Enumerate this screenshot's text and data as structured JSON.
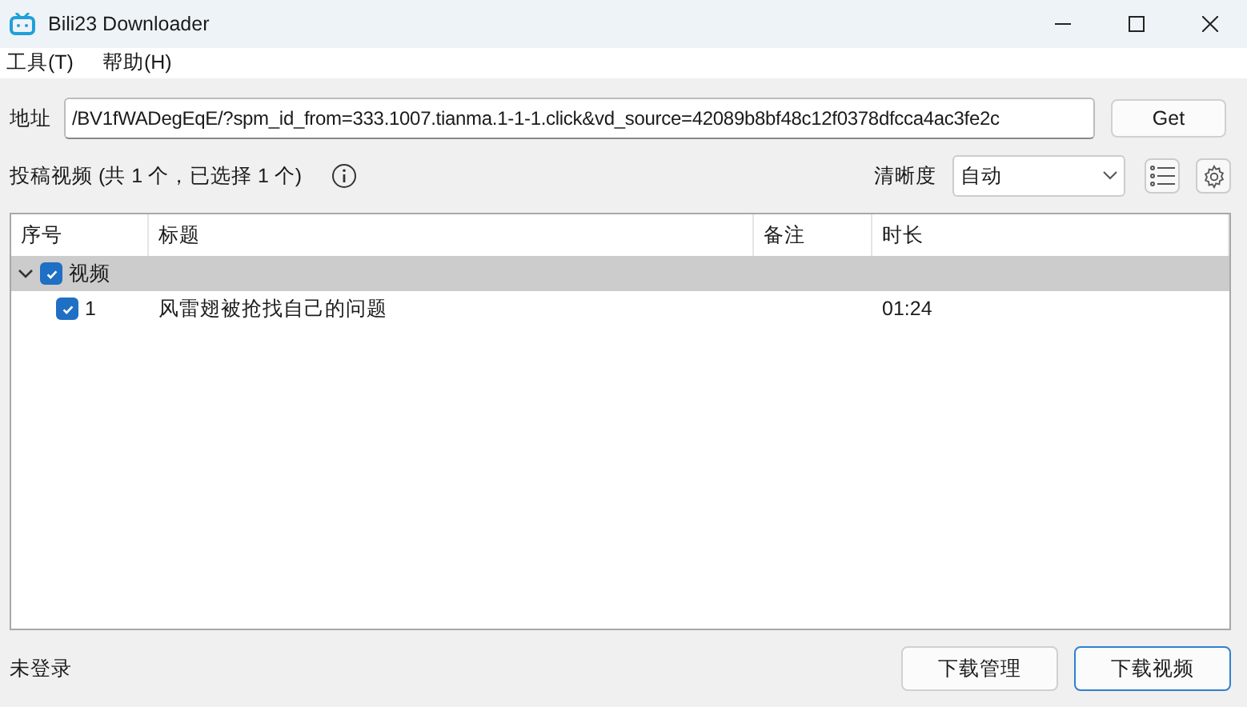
{
  "window": {
    "title": "Bili23 Downloader"
  },
  "menu": [
    "工具(T)",
    "帮助(H)"
  ],
  "address": {
    "label": "地址",
    "value": "/BV1fWADegEqE/?spm_id_from=333.1007.tianma.1-1-1.click&vd_source=42089b8bf48c12f0378dfcca4ac3fe2c",
    "button": "Get"
  },
  "summary": "投稿视频 (共 1 个，已选择 1 个)",
  "quality": {
    "label": "清晰度",
    "value": "自动"
  },
  "table": {
    "columns": [
      "序号",
      "标题",
      "备注",
      "时长"
    ],
    "groups": [
      {
        "label": "视频",
        "expanded": true,
        "checked": true,
        "rows": [
          {
            "index": "1",
            "title": "风雷翅被抢找自己的问题",
            "note": "",
            "duration": "01:24",
            "checked": true
          }
        ]
      }
    ]
  },
  "status": "未登录",
  "buttons": [
    {
      "label": "下载管理",
      "primary": false
    },
    {
      "label": "下载视频",
      "primary": true
    }
  ]
}
